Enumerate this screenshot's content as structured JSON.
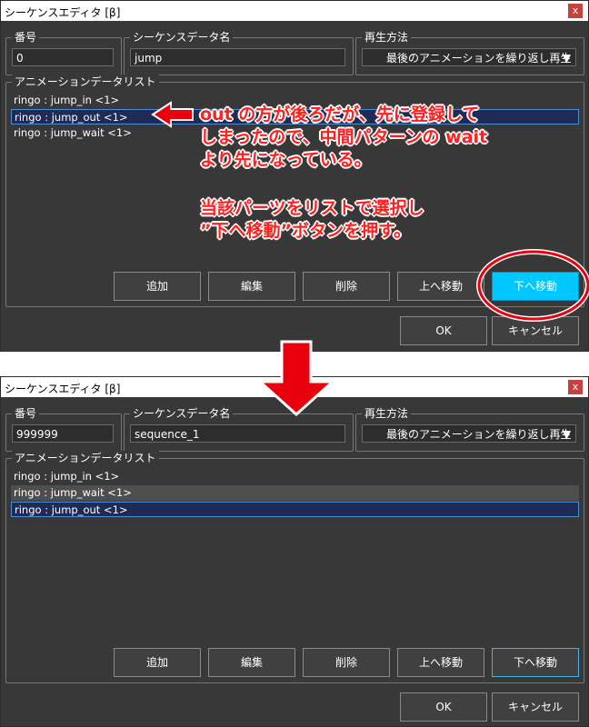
{
  "colors": {
    "accent_cyan": "#00c8ff",
    "annotation_red": "#e8000e",
    "selection_blue": "#1e2b56"
  },
  "dialog_before": {
    "title": "シーケンスエディタ [β]",
    "close_glyph": "x",
    "number_label": "番号",
    "number_value": "0",
    "name_label": "シーケンスデータ名",
    "name_value": "jump",
    "play_label": "再生方法",
    "play_value": "最後のアニメーションを繰り返し再生",
    "list_label": "アニメーションデータリスト",
    "items": [
      "ringo : jump_in  <1>",
      "ringo : jump_out  <1>",
      "ringo : jump_wait  <1>"
    ],
    "buttons": {
      "add": "追加",
      "edit": "編集",
      "delete": "削除",
      "up": "上へ移動",
      "down": "下へ移動"
    },
    "ok": "OK",
    "cancel": "キャンセル"
  },
  "dialog_after": {
    "title": "シーケンスエディタ [β]",
    "close_glyph": "x",
    "number_label": "番号",
    "number_value": "999999",
    "name_label": "シーケンスデータ名",
    "name_value": "sequence_1",
    "play_label": "再生方法",
    "play_value": "最後のアニメーションを繰り返し再生",
    "list_label": "アニメーションデータリスト",
    "items": [
      "ringo : jump_in  <1>",
      "ringo : jump_wait  <1>",
      "ringo : jump_out  <1>"
    ],
    "buttons": {
      "add": "追加",
      "edit": "編集",
      "delete": "削除",
      "up": "上へ移動",
      "down": "下へ移動"
    },
    "ok": "OK",
    "cancel": "キャンセル"
  },
  "annotation": {
    "line1": "out の方が後ろだが、先に登録して",
    "line2": "しまったので、中間パターンの wait",
    "line3": "より先になっている。",
    "line4": "当該パーツをリストで選択し",
    "line5": "”下へ移動”ボタンを押す。"
  }
}
